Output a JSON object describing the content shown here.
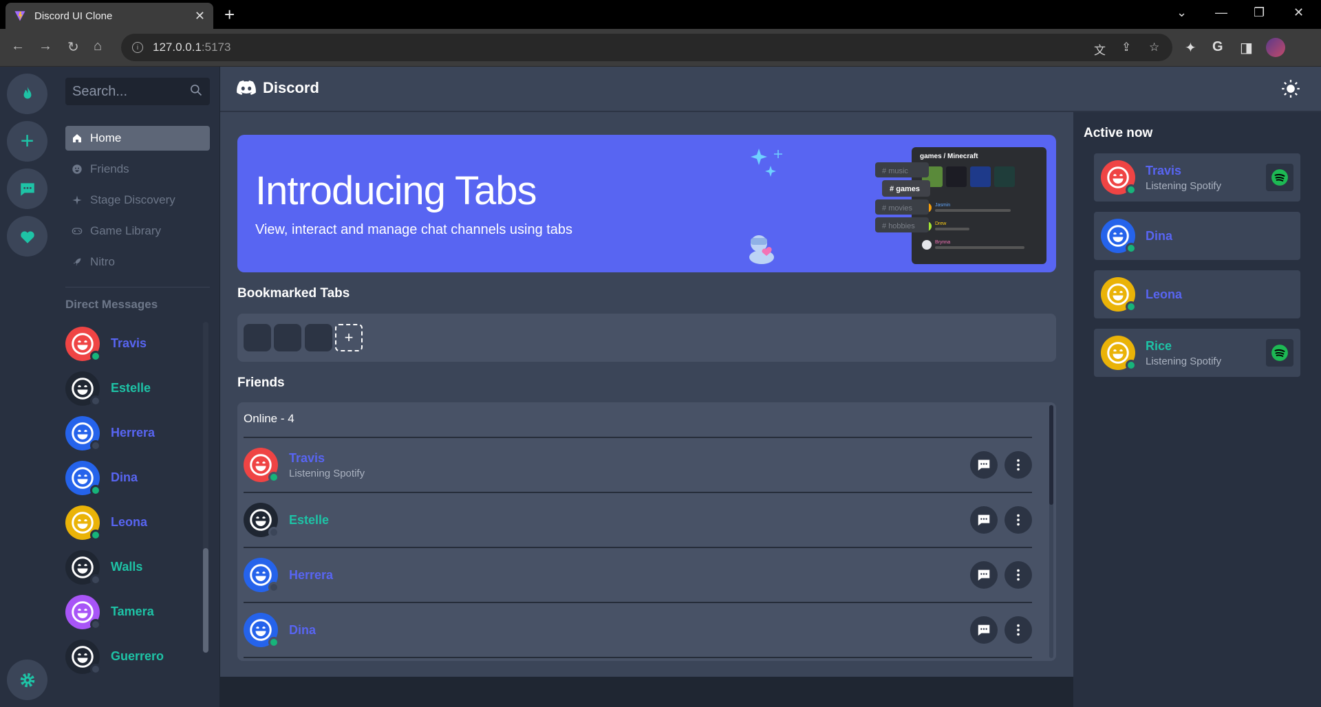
{
  "browser": {
    "tab_title": "Discord UI Clone",
    "url_host": "127.0.0.1",
    "url_port": ":5173"
  },
  "app": {
    "brand": "Discord",
    "search_placeholder": "Search...",
    "nav": [
      {
        "label": "Home",
        "icon": "home-icon"
      },
      {
        "label": "Friends",
        "icon": "smile-icon"
      },
      {
        "label": "Stage Discovery",
        "icon": "sparkle-icon"
      },
      {
        "label": "Game Library",
        "icon": "gamepad-icon"
      },
      {
        "label": "Nitro",
        "icon": "rocket-icon"
      }
    ],
    "dm_title": "Direct Messages",
    "dms": [
      {
        "name": "Travis",
        "color": "#ef4444",
        "name_color": "#5865f2",
        "status": "online"
      },
      {
        "name": "Estelle",
        "color": "#1f2632",
        "name_color": "#1ec3a6",
        "status": "offline"
      },
      {
        "name": "Herrera",
        "color": "#2563eb",
        "name_color": "#5865f2",
        "status": "offline"
      },
      {
        "name": "Dina",
        "color": "#2563eb",
        "name_color": "#5865f2",
        "status": "online"
      },
      {
        "name": "Leona",
        "color": "#eab308",
        "name_color": "#5865f2",
        "status": "online"
      },
      {
        "name": "Walls",
        "color": "#1f2632",
        "name_color": "#1ec3a6",
        "status": "offline"
      },
      {
        "name": "Tamera",
        "color": "#a855f7",
        "name_color": "#1ec3a6",
        "status": "offline"
      },
      {
        "name": "Guerrero",
        "color": "#1f2632",
        "name_color": "#1ec3a6",
        "status": "offline"
      }
    ]
  },
  "banner": {
    "title": "Introducing Tabs",
    "subtitle": "View, interact and manage chat channels using tabs",
    "channels": [
      "music",
      "games",
      "movies",
      "hobbies"
    ],
    "chat_header": "games / Minecraft",
    "chat_users": [
      "Jasmin",
      "Drew",
      "Brynna"
    ]
  },
  "bookmarked": {
    "title": "Bookmarked Tabs",
    "add_label": "+"
  },
  "friends": {
    "title": "Friends",
    "online_label": "Online - 4",
    "rows": [
      {
        "name": "Travis",
        "status_text": "Listening Spotify",
        "color": "#ef4444",
        "name_color": "#5865f2",
        "status": "online"
      },
      {
        "name": "Estelle",
        "status_text": "",
        "color": "#1f2632",
        "name_color": "#1ec3a6",
        "status": "offline"
      },
      {
        "name": "Herrera",
        "status_text": "",
        "color": "#2563eb",
        "name_color": "#5865f2",
        "status": "offline"
      },
      {
        "name": "Dina",
        "status_text": "",
        "color": "#2563eb",
        "name_color": "#5865f2",
        "status": "online"
      }
    ]
  },
  "active_now": {
    "title": "Active now",
    "items": [
      {
        "name": "Travis",
        "status_text": "Listening Spotify",
        "color": "#ef4444",
        "name_color": "#5865f2",
        "spotify": true
      },
      {
        "name": "Dina",
        "status_text": "",
        "color": "#2563eb",
        "name_color": "#5865f2",
        "spotify": false
      },
      {
        "name": "Leona",
        "status_text": "",
        "color": "#eab308",
        "name_color": "#5865f2",
        "spotify": false
      },
      {
        "name": "Rice",
        "status_text": "Listening Spotify",
        "color": "#eab308",
        "name_color": "#1ec3a6",
        "spotify": true
      }
    ]
  },
  "colors": {
    "accent": "#5865f2",
    "teal": "#1ec3a6",
    "online": "#17b47a"
  }
}
